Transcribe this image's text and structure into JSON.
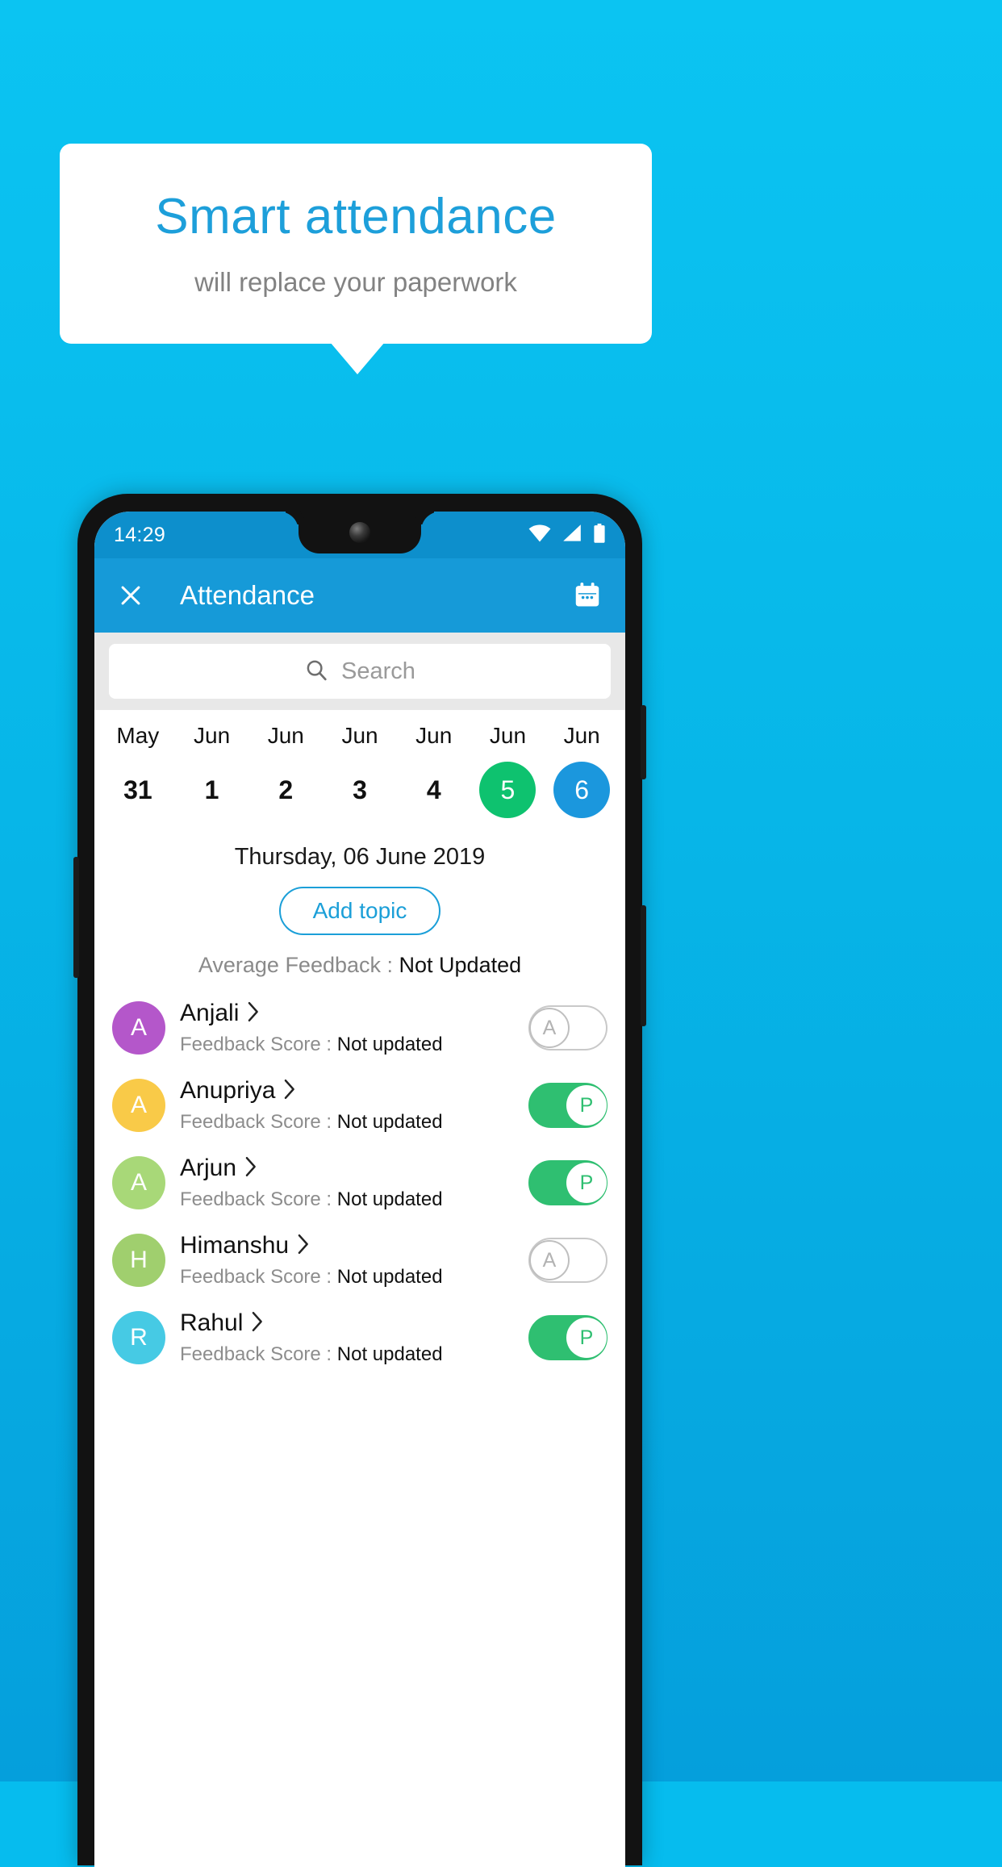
{
  "promo": {
    "headline": "Smart attendance",
    "subheadline": "will replace your paperwork",
    "background_color": "#06bcee",
    "headline_color": "#1d9fda"
  },
  "phone": {
    "statusbar": {
      "time": "14:29",
      "icons": [
        "wifi-icon",
        "signal-icon",
        "battery-icon"
      ]
    },
    "appbar": {
      "close_icon": "close-icon",
      "title": "Attendance",
      "calendar_icon": "calendar-icon",
      "color": "#169ad8"
    },
    "search": {
      "icon": "search-icon",
      "placeholder": "Search"
    },
    "dates": [
      {
        "month": "May",
        "day": "31",
        "state": "normal"
      },
      {
        "month": "Jun",
        "day": "1",
        "state": "normal"
      },
      {
        "month": "Jun",
        "day": "2",
        "state": "normal"
      },
      {
        "month": "Jun",
        "day": "3",
        "state": "normal"
      },
      {
        "month": "Jun",
        "day": "4",
        "state": "normal"
      },
      {
        "month": "Jun",
        "day": "5",
        "state": "today"
      },
      {
        "month": "Jun",
        "day": "6",
        "state": "selected"
      }
    ],
    "day_label": "Thursday, 06 June 2019",
    "add_topic_label": "Add topic",
    "average_feedback": {
      "label": "Average Feedback : ",
      "value": "Not Updated"
    },
    "score_label": "Feedback Score : ",
    "students": [
      {
        "name": "Anjali",
        "initial": "A",
        "avatar_color": "#b457ca",
        "score_value": "Not updated",
        "attendance": "absent",
        "toggle_label": "A"
      },
      {
        "name": "Anupriya",
        "initial": "A",
        "avatar_color": "#f9ca48",
        "score_value": "Not updated",
        "attendance": "present",
        "toggle_label": "P"
      },
      {
        "name": "Arjun",
        "initial": "A",
        "avatar_color": "#a8d878",
        "score_value": "Not updated",
        "attendance": "present",
        "toggle_label": "P"
      },
      {
        "name": "Himanshu",
        "initial": "H",
        "avatar_color": "#a0cf6e",
        "score_value": "Not updated",
        "attendance": "absent",
        "toggle_label": "A"
      },
      {
        "name": "Rahul",
        "initial": "R",
        "avatar_color": "#46cae4",
        "score_value": "Not updated",
        "attendance": "present",
        "toggle_label": "P"
      }
    ]
  },
  "colors": {
    "present_green": "#2fbf71",
    "today_green": "#0ec26f",
    "selected_blue": "#1b97dd",
    "accent_blue": "#1b9fd8"
  }
}
